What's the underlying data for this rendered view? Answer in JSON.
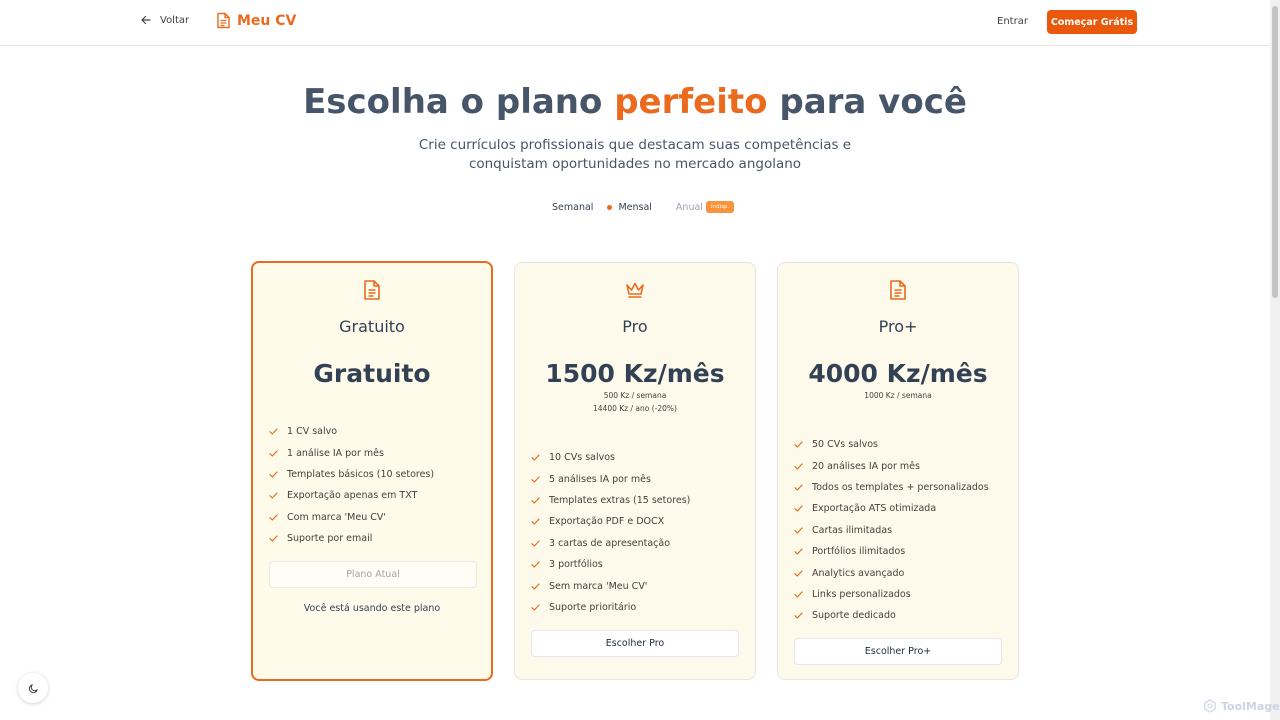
{
  "header": {
    "back_label": "Voltar",
    "brand": "Meu CV",
    "login_label": "Entrar",
    "cta_label": "Começar Grátis"
  },
  "hero": {
    "title_before": "Escolha o plano ",
    "title_highlight": "perfeito",
    "title_after": " para você",
    "subtitle_line1": "Crie currículos profissionais que destacam suas competências e",
    "subtitle_line2": "conquistam oportunidades no mercado angolano"
  },
  "billing": {
    "options": [
      "Semanal",
      "Mensal",
      "Anual"
    ],
    "selected": "Mensal",
    "badge": "Indisp."
  },
  "plans": [
    {
      "icon": "document-icon",
      "name": "Gratuito",
      "price": "Gratuito",
      "price_subs": [],
      "features": [
        "1 CV salvo",
        "1 análise IA por mês",
        "Templates básicos (10 setores)",
        "Exportação apenas em TXT",
        "Com marca 'Meu CV'",
        "Suporte por email"
      ],
      "button": "Plano Atual",
      "note": "Você está usando este plano"
    },
    {
      "icon": "crown-icon",
      "name": "Pro",
      "price": "1500 Kz/mês",
      "price_subs": [
        "500 Kz / semana",
        "14400 Kz / ano (-20%)"
      ],
      "features": [
        "10 CVs salvos",
        "5 análises IA por mês",
        "Templates extras (15 setores)",
        "Exportação PDF e DOCX",
        "3 cartas de apresentação",
        "3 portfólios",
        "Sem marca 'Meu CV'",
        "Suporte prioritário"
      ],
      "button": "Escolher Pro"
    },
    {
      "icon": "document-icon",
      "name": "Pro+",
      "price": "4000 Kz/mês",
      "price_subs": [
        "1000 Kz / semana"
      ],
      "features": [
        "50 CVs salvos",
        "20 análises IA por mês",
        "Todos os templates + personalizados",
        "Exportação ATS otimizada",
        "Cartas ilimitadas",
        "Portfólios ilimitados",
        "Analytics avançado",
        "Links personalizados",
        "Suporte dedicado"
      ],
      "button": "Escolher Pro+"
    }
  ],
  "watermark": "ToolMage",
  "colors": {
    "accent": "#ea6a1e",
    "card_bg": "#fefaeb",
    "heading": "#475569"
  }
}
